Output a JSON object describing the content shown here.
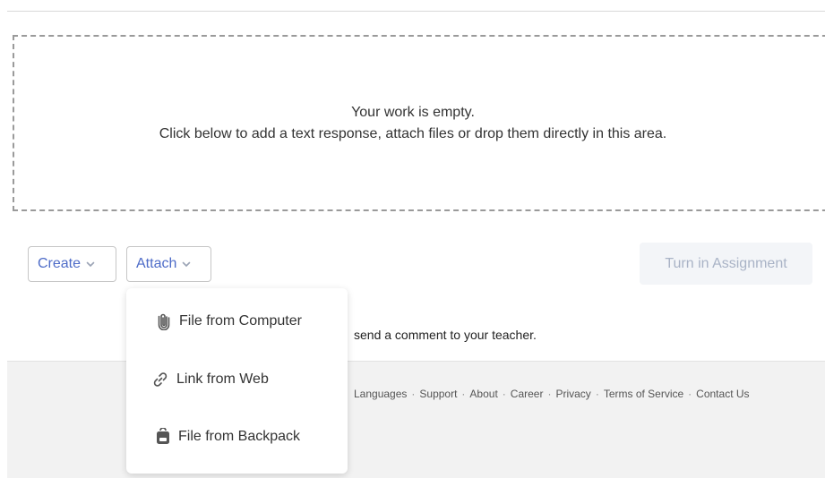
{
  "dropzone": {
    "line1": "Your work is empty.",
    "line2": "Click below to add a text response, attach files or drop them directly in this area."
  },
  "toolbar": {
    "create_label": "Create",
    "attach_label": "Attach",
    "turnin_label": "Turn in Assignment"
  },
  "comment_text": "send a comment to your teacher.",
  "attach_menu": {
    "items": [
      {
        "label": "File from Computer",
        "icon": "paperclip-icon"
      },
      {
        "label": "Link from Web",
        "icon": "link-icon"
      },
      {
        "label": "File from Backpack",
        "icon": "backpack-icon"
      }
    ]
  },
  "footer": {
    "links": [
      "Languages",
      "Support",
      "About",
      "Career",
      "Privacy",
      "Terms of Service",
      "Contact Us"
    ]
  },
  "colors": {
    "accent": "#4e6cc8",
    "disabled_text": "#a9b3c6",
    "footer_bg": "#f2f2f2"
  }
}
